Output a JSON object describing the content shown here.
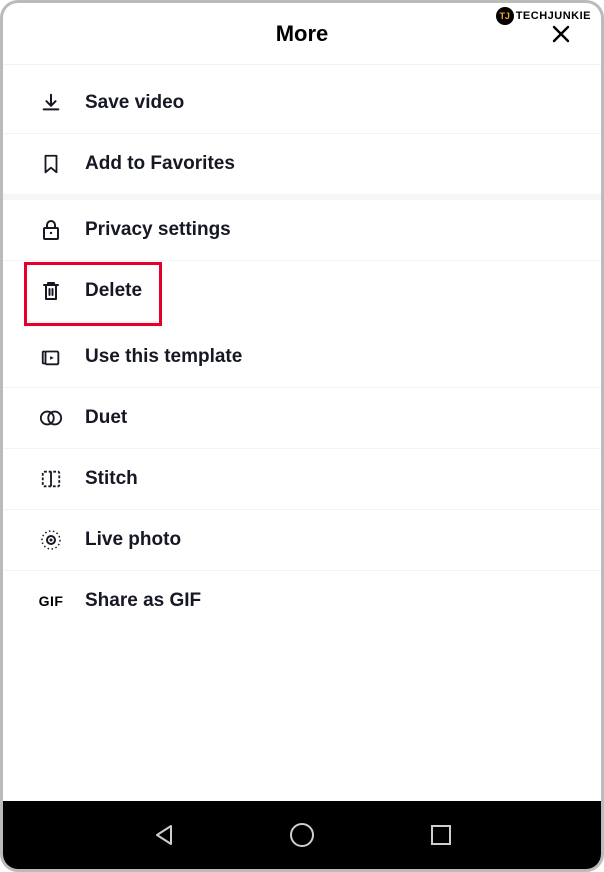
{
  "watermark": {
    "badge": "TJ",
    "text": "TECHJUNKIE"
  },
  "header": {
    "title": "More"
  },
  "menu": {
    "items": [
      {
        "label": "Save video"
      },
      {
        "label": "Add to Favorites"
      },
      {
        "label": "Privacy settings"
      },
      {
        "label": "Delete"
      },
      {
        "label": "Use this template"
      },
      {
        "label": "Duet"
      },
      {
        "label": "Stitch"
      },
      {
        "label": "Live photo"
      },
      {
        "label": "Share as GIF"
      }
    ]
  }
}
